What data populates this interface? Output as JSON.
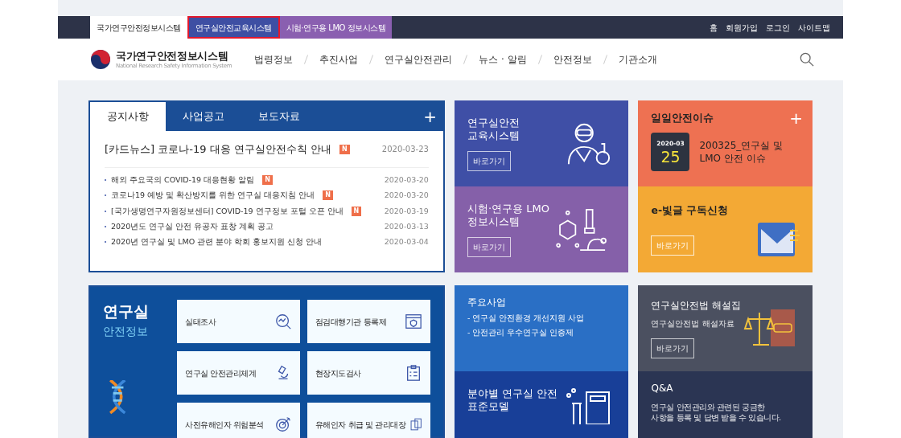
{
  "top_bar": {
    "systems": [
      {
        "label": "국가연구안전정보시스템",
        "selected": true,
        "outlined": false,
        "color": "#ffffff"
      },
      {
        "label": "연구실안전교육시스템",
        "selected": false,
        "outlined": true,
        "color": "#3e4fa3"
      },
      {
        "label": "시험·연구용 LMO 정보시스템",
        "selected": false,
        "outlined": false,
        "color": "#8a5fb0"
      }
    ],
    "links": [
      "홈",
      "회원가입",
      "로그인",
      "사이트맵"
    ]
  },
  "header": {
    "logo_title": "국가연구안전정보시스템",
    "logo_subtitle": "National Research Safety Information System",
    "nav": [
      "법령정보",
      "추진사업",
      "연구실안전관리",
      "뉴스 · 알림",
      "안전정보",
      "기관소개"
    ]
  },
  "notice_panel": {
    "tabs": [
      {
        "label": "공지사항",
        "selected": true
      },
      {
        "label": "사업공고",
        "selected": false
      },
      {
        "label": "보도자료",
        "selected": false
      }
    ],
    "more": "+",
    "headline": {
      "title": "[카드뉴스] 코로나-19 대응 연구실안전수칙 안내",
      "new": true,
      "badge": "N",
      "date": "2020-03-23"
    },
    "items": [
      {
        "title": "해외 주요국의 COVID-19 대응현황 알림",
        "new": true,
        "badge": "N",
        "date": "2020-03-20"
      },
      {
        "title": "코로나19 예방 및 확산방지를 위한 연구실 대응지침 안내",
        "new": true,
        "badge": "N",
        "date": "2020-03-20"
      },
      {
        "title": "[국가생명연구자원정보센터] COVID-19 연구정보 포털 오픈 안내",
        "new": true,
        "badge": "N",
        "date": "2020-03-19"
      },
      {
        "title": "2020년도 연구실 안전 유공자 표창 계획 공고",
        "new": false,
        "date": "2020-03-13"
      },
      {
        "title": "2020년 연구실 및 LMO 관련 분야 학회 홍보지원 신청 안내",
        "new": false,
        "date": "2020-03-04"
      }
    ]
  },
  "tiles": [
    {
      "kind": "edu",
      "title": "연구실안전\n교육시스템",
      "button": "바로가기"
    },
    {
      "kind": "lmo",
      "title": "시험·연구용 LMO\n정보시스템",
      "button": "바로가기"
    }
  ],
  "daily_issue": {
    "title": "일일안전이슈",
    "more": "+",
    "month": "2020-03",
    "day": "25",
    "text": "200325_연구실 및\nLMO 안전 이슈"
  },
  "newsletter": {
    "title": "e-빛글 구독신청",
    "button": "바로가기"
  },
  "lab_info": {
    "title": "연구실",
    "subtitle": "안전정보",
    "items": [
      {
        "label": "실태조사",
        "kind": "chart"
      },
      {
        "label": "점검대행기관 등록제",
        "kind": "shield"
      },
      {
        "label": "연구실 안전관리체계",
        "kind": "microscope"
      },
      {
        "label": "현장지도검사",
        "kind": "checklist"
      },
      {
        "label": "사전유해인자 위험분석",
        "kind": "target"
      },
      {
        "label": "유해인자 취급 및 관리대장",
        "kind": "docs"
      }
    ]
  },
  "major_projects": {
    "title": "주요사업",
    "items": [
      "- 연구실 안전환경 개선지원 사업",
      "- 안전관리 우수연구실 인증제"
    ]
  },
  "law_guide": {
    "title": "연구실안전법 해설집",
    "text": "연구실안전법 해설자료",
    "button": "바로가기"
  },
  "standard_model": {
    "title": "분야별 연구실 안전\n표준모델"
  },
  "qna": {
    "title": "Q&A",
    "text": "연구실 안전관리와 관련된 궁금한\n사항을 등록 및 답변 받을 수 있습니다."
  }
}
